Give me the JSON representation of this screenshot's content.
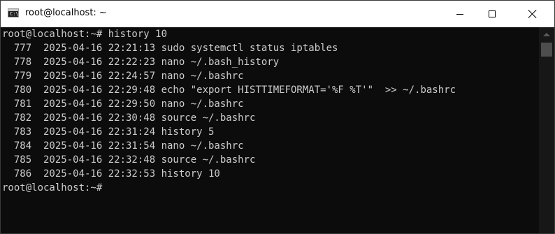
{
  "window": {
    "title": "root@localhost: ~",
    "icon_label": "C:\\"
  },
  "terminal": {
    "lines": [
      "root@localhost:~# history 10",
      "  777  2025-04-16 22:21:13 sudo systemctl status iptables",
      "  778  2025-04-16 22:22:23 nano ~/.bash_history",
      "  779  2025-04-16 22:24:57 nano ~/.bashrc",
      "  780  2025-04-16 22:29:48 echo \"export HISTTIMEFORMAT='%F %T'\"  >> ~/.bashrc",
      "  781  2025-04-16 22:29:50 nano ~/.bashrc",
      "  782  2025-04-16 22:30:48 source ~/.bashrc",
      "  783  2025-04-16 22:31:24 history 5",
      "  784  2025-04-16 22:31:54 nano ~/.bashrc",
      "  785  2025-04-16 22:32:48 source ~/.bashrc",
      "  786  2025-04-16 22:32:53 history 10",
      "root@localhost:~# "
    ]
  }
}
